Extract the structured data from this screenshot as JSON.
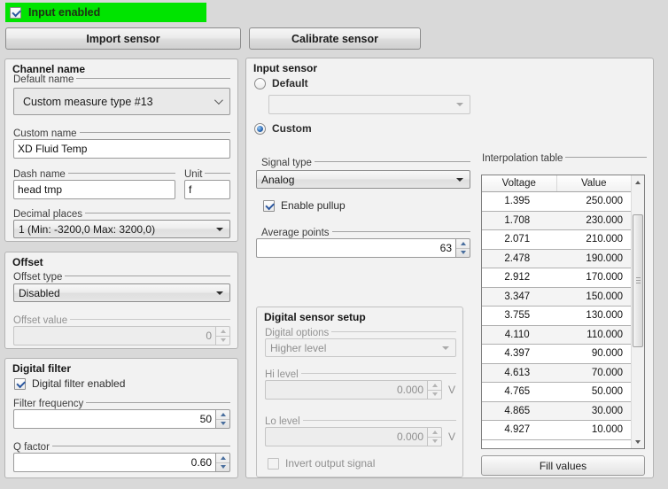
{
  "header": {
    "input_enabled_label": "Input enabled",
    "highlight_color": "#00e400"
  },
  "toolbar": {
    "import_button": "Import sensor",
    "calibrate_button": "Calibrate sensor"
  },
  "channel_name": {
    "title": "Channel name",
    "default_name_label": "Default name",
    "default_name_value": "Custom measure type #13",
    "custom_name_label": "Custom name",
    "custom_name_value": "XD Fluid Temp",
    "dash_name_label": "Dash name",
    "dash_name_value": "head tmp",
    "unit_label": "Unit",
    "unit_value": "f",
    "decimal_places_label": "Decimal places",
    "decimal_places_value": "1 (Min: -3200,0 Max: 3200,0)"
  },
  "offset": {
    "title": "Offset",
    "offset_type_label": "Offset type",
    "offset_type_value": "Disabled",
    "offset_value_label": "Offset value",
    "offset_value_value": "0"
  },
  "digital_filter": {
    "title": "Digital filter",
    "enabled_label": "Digital filter enabled",
    "filter_frequency_label": "Filter frequency",
    "filter_frequency_value": "50",
    "q_factor_label": "Q factor",
    "q_factor_value": "0.60"
  },
  "input_sensor": {
    "title": "Input sensor",
    "default_radio_label": "Default",
    "default_combo_value": "",
    "custom_radio_label": "Custom",
    "signal_type_label": "Signal type",
    "signal_type_value": "Analog",
    "enable_pullup_label": "Enable pullup",
    "average_points_label": "Average points",
    "average_points_value": "63"
  },
  "digital_sensor_setup": {
    "title": "Digital sensor setup",
    "digital_options_label": "Digital options",
    "digital_options_value": "Higher level",
    "hi_level_label": "Hi level",
    "hi_level_value": "0.000",
    "hi_level_unit": "V",
    "lo_level_label": "Lo level",
    "lo_level_value": "0.000",
    "lo_level_unit": "V",
    "invert_label": "Invert output signal"
  },
  "interpolation_table": {
    "label": "Interpolation table",
    "columns": [
      "Voltage",
      "Value"
    ],
    "rows": [
      [
        "1.395",
        "250.000"
      ],
      [
        "1.708",
        "230.000"
      ],
      [
        "2.071",
        "210.000"
      ],
      [
        "2.478",
        "190.000"
      ],
      [
        "2.912",
        "170.000"
      ],
      [
        "3.347",
        "150.000"
      ],
      [
        "3.755",
        "130.000"
      ],
      [
        "4.110",
        "110.000"
      ],
      [
        "4.397",
        "90.000"
      ],
      [
        "4.613",
        "70.000"
      ],
      [
        "4.765",
        "50.000"
      ],
      [
        "4.865",
        "30.000"
      ],
      [
        "4.927",
        "10.000"
      ]
    ],
    "fill_button": "Fill values"
  }
}
